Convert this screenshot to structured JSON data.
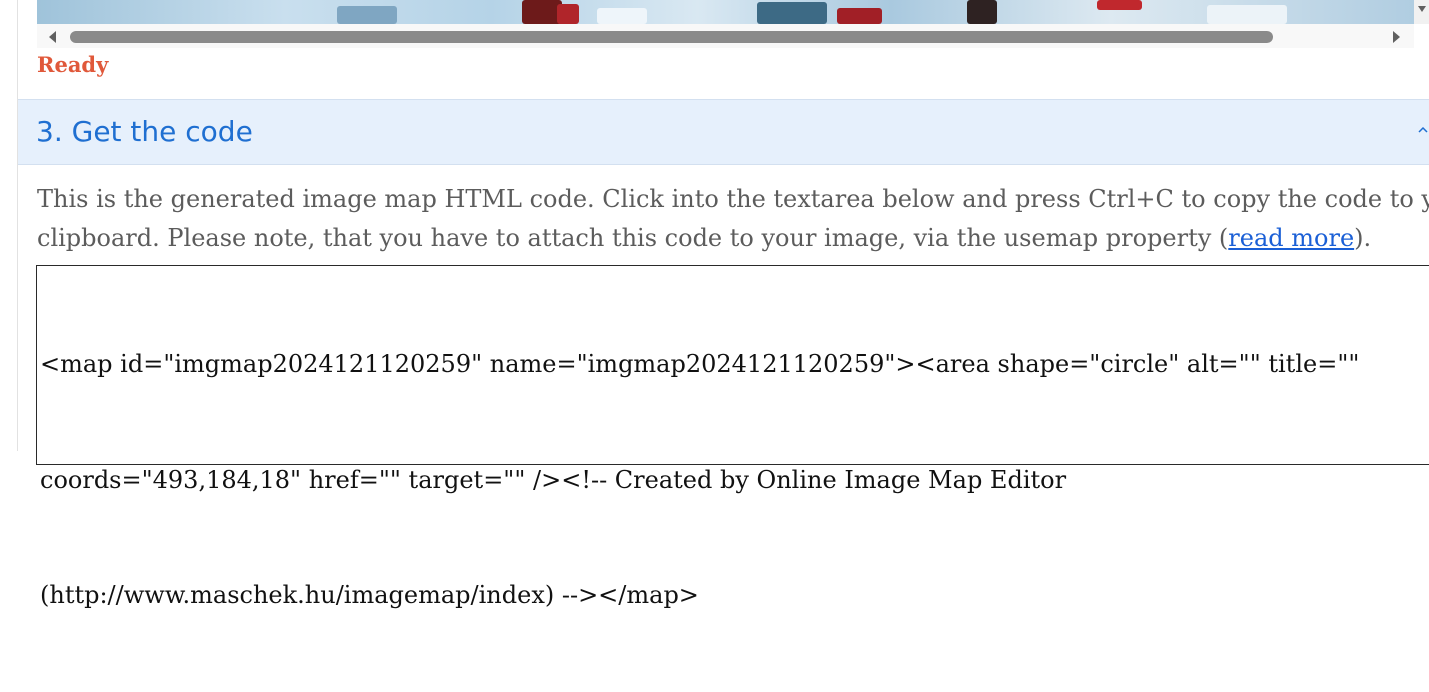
{
  "status": {
    "text": "Ready",
    "color": "#e0583a"
  },
  "section": {
    "title": "3. Get the code",
    "toggle_icon": "chevron-up-icon"
  },
  "description": {
    "line1": "This is the generated image map HTML code. Click into the textarea below and press Ctrl+C to copy the code to your",
    "line2_before": "clipboard. Please note, that you have to attach this code to your image, via the usemap property (",
    "link_text": "read more",
    "line2_after": ")."
  },
  "code": {
    "line1": "<map id=\"imgmap2024121120259\" name=\"imgmap2024121120259\"><area shape=\"circle\" alt=\"\" title=\"\"",
    "line2": "coords=\"493,184,18\" href=\"\" target=\"\" /><!-- Created by Online Image Map Editor",
    "line3": "(http://www.maschek.hu/imagemap/index) --></map>"
  },
  "colors": {
    "accent": "#1f6fd1",
    "header_bg": "#e6f0fc",
    "link": "#1a5fd6"
  }
}
